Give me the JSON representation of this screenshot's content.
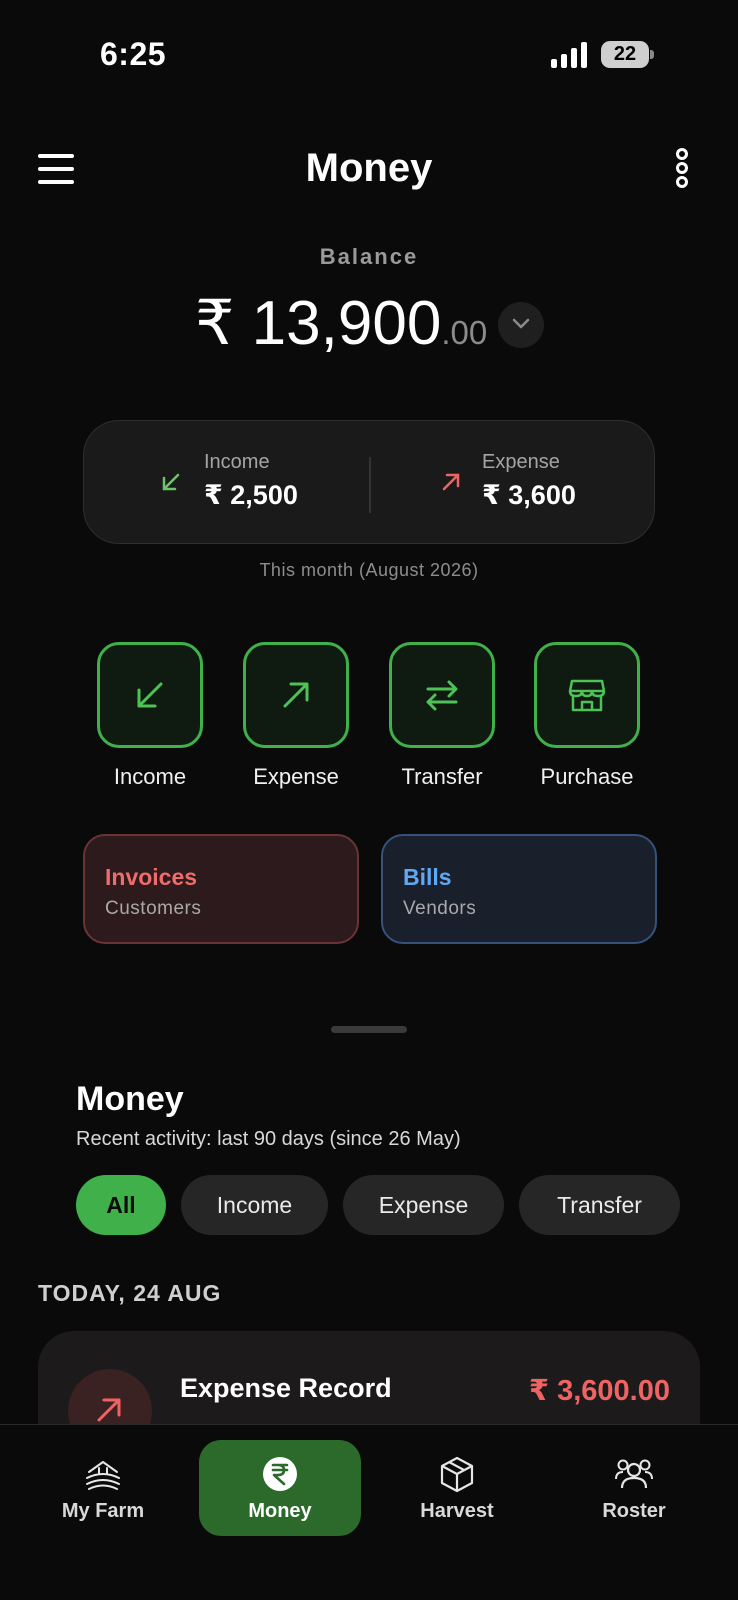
{
  "status": {
    "time": "6:25",
    "battery": "22"
  },
  "header": {
    "title": "Money"
  },
  "balance": {
    "label": "Balance",
    "whole": "₹ 13,900",
    "decimal": ".00"
  },
  "summary": {
    "income_label": "Income",
    "income_value": "₹ 2,500",
    "expense_label": "Expense",
    "expense_value": "₹ 3,600",
    "note": "This month (August 2026)"
  },
  "actions": [
    {
      "label": "Income",
      "icon": "arrow-down-left-icon"
    },
    {
      "label": "Expense",
      "icon": "arrow-up-right-icon"
    },
    {
      "label": "Transfer",
      "icon": "transfer-icon"
    },
    {
      "label": "Purchase",
      "icon": "store-icon"
    }
  ],
  "cards": {
    "invoices": {
      "title": "Invoices",
      "subtitle": "Customers"
    },
    "bills": {
      "title": "Bills",
      "subtitle": "Vendors"
    }
  },
  "activity": {
    "title": "Money",
    "subtitle": "Recent activity: last 90 days (since 26 May)",
    "filters": [
      "All",
      "Income",
      "Expense",
      "Transfer"
    ],
    "active_filter": "All",
    "date_header": "TODAY, 24 AUG",
    "transactions": [
      {
        "name": "Expense Record",
        "amount": "₹ 3,600.00"
      }
    ]
  },
  "tabs": [
    {
      "label": "My Farm",
      "icon": "farm-icon"
    },
    {
      "label": "Money",
      "icon": "rupee-icon"
    },
    {
      "label": "Harvest",
      "icon": "box-icon"
    },
    {
      "label": "Roster",
      "icon": "people-icon"
    }
  ],
  "colors": {
    "accent": "#3fb04a",
    "income": "#6cc36a",
    "expense": "#f06363",
    "invoices": "#f06b6b",
    "bills": "#5fa8f5"
  }
}
